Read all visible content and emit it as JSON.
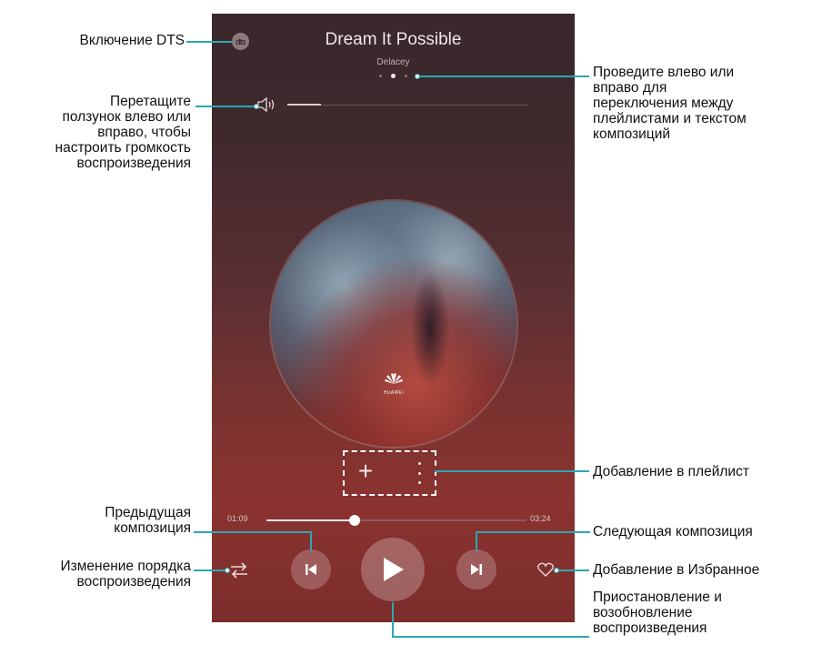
{
  "player": {
    "song_title": "Dream It Possible",
    "artist": "Delacey",
    "current_time": "01:09",
    "total_time": "03:24",
    "progress_fraction": 0.34,
    "volume_fraction": 0.14,
    "page_indicator": {
      "count": 3,
      "active": 1
    },
    "album_logo_text": "HUAWEI",
    "dts_label": "dts"
  },
  "annotations": {
    "dts": "Включение DTS",
    "volume": [
      "Перетащите",
      "ползунок влево или",
      "вправо, чтобы",
      "настроить громкость",
      "воспроизведения"
    ],
    "swipe": [
      "Проведите влево или",
      "вправо для",
      "переключения между",
      "плейлистами и текстом",
      "композиций"
    ],
    "playlist_add": "Добавление в плейлист",
    "previous": [
      "Предыдущая",
      "композиция"
    ],
    "next": "Следующая композиция",
    "shuffle": [
      "Изменение порядка",
      "воспроизведения"
    ],
    "favorite": "Добавление в Избранное",
    "play_pause": [
      "Приостановление и",
      "возобновление",
      "воспроизведения"
    ]
  },
  "colors": {
    "callout_line": "#2aa7b3",
    "screen_top": "#39282c",
    "screen_bottom": "#8b3330"
  },
  "icons": [
    "dts-icon",
    "volume-icon",
    "plus-icon",
    "more-icon",
    "shuffle-icon",
    "previous-icon",
    "play-icon",
    "next-icon",
    "heart-icon"
  ]
}
